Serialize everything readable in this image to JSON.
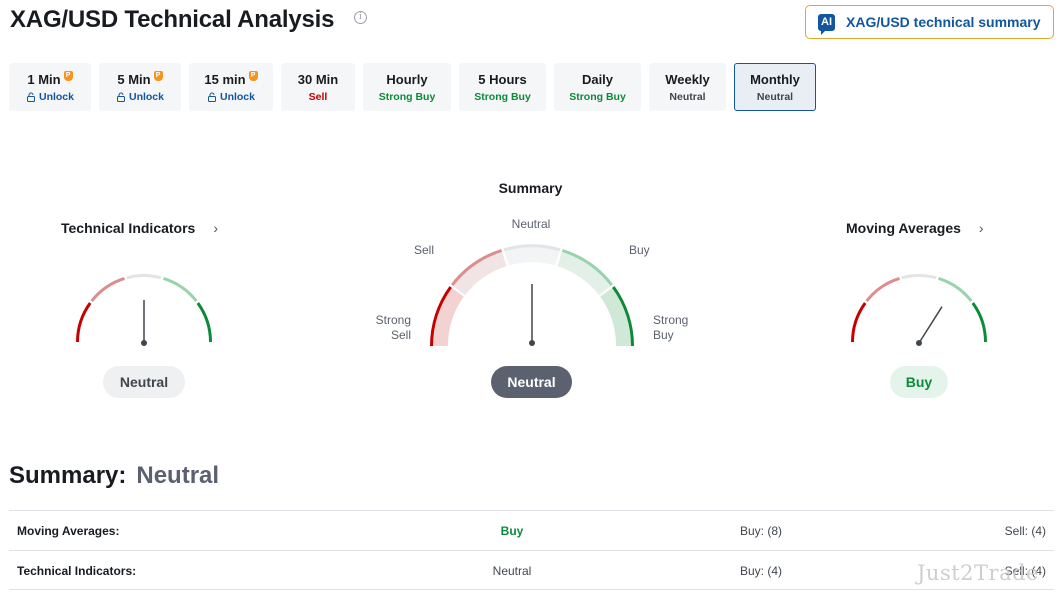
{
  "header": {
    "title": "XAG/USD Technical Analysis",
    "ai_button_badge": "AI",
    "ai_button_label": "XAG/USD technical summary"
  },
  "tabs": [
    {
      "label": "1 Min",
      "sub": "Unlock",
      "locked": true,
      "color": "#1256a0"
    },
    {
      "label": "5 Min",
      "sub": "Unlock",
      "locked": true,
      "color": "#1256a0"
    },
    {
      "label": "15 min",
      "sub": "Unlock",
      "locked": true,
      "color": "#1256a0"
    },
    {
      "label": "30 Min",
      "sub": "Sell",
      "locked": false,
      "color": "#c40000"
    },
    {
      "label": "Hourly",
      "sub": "Strong Buy",
      "locked": false,
      "color": "#0c8a3a"
    },
    {
      "label": "5 Hours",
      "sub": "Strong Buy",
      "locked": false,
      "color": "#0c8a3a"
    },
    {
      "label": "Daily",
      "sub": "Strong Buy",
      "locked": false,
      "color": "#0c8a3a"
    },
    {
      "label": "Weekly",
      "sub": "Neutral",
      "locked": false,
      "color": "#41464d"
    },
    {
      "label": "Monthly",
      "sub": "Neutral",
      "locked": false,
      "active": true,
      "color": "#41464d"
    }
  ],
  "gauges": {
    "summary_title": "Summary",
    "summary_labels": {
      "strong_sell": "Strong Sell",
      "sell": "Sell",
      "neutral": "Neutral",
      "buy": "Buy",
      "strong_buy": "Strong Buy"
    },
    "technical_indicators": {
      "title": "Technical Indicators",
      "signal": "Neutral",
      "needle_level": 0.5
    },
    "summary": {
      "signal": "Neutral",
      "needle_level": 0.5
    },
    "moving_averages": {
      "title": "Moving Averages",
      "signal": "Buy",
      "needle_level": 0.68
    }
  },
  "summary_section": {
    "label": "Summary:",
    "value": "Neutral",
    "rows": [
      {
        "name": "Moving Averages:",
        "signal": "Buy",
        "buy": "Buy: (8)",
        "sell": "Sell: (4)"
      },
      {
        "name": "Technical Indicators:",
        "signal": "Neutral",
        "buy": "Buy: (4)",
        "sell": "Sell: (4)"
      }
    ]
  },
  "watermark": "Just2Trade",
  "colors": {
    "strong_sell": "#c40000",
    "sell": "#dc8d8d",
    "neutral": "#e2e4e7",
    "buy": "#98d3ac",
    "strong_buy": "#0c8a3a",
    "accent": "#1256a0",
    "ai_border": "#e0a82e"
  }
}
